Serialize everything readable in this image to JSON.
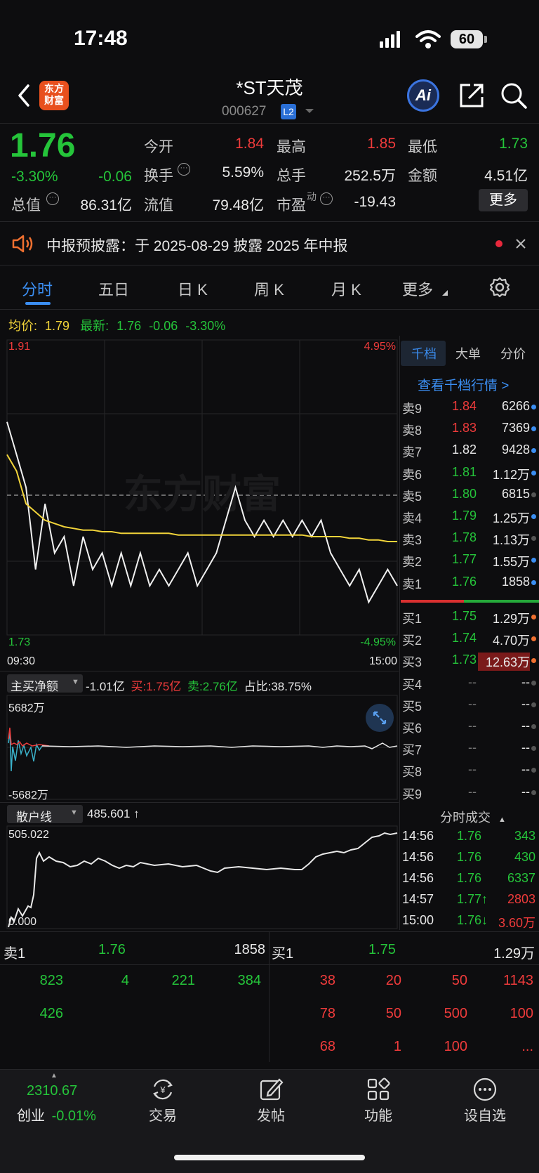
{
  "status_bar": {
    "time": "17:48",
    "battery": "60"
  },
  "header": {
    "logo_line1": "东方",
    "logo_line2": "财富",
    "stock_name": "*ST天茂",
    "stock_code": "000627",
    "level_badge": "L2",
    "ai_label": "Ai"
  },
  "quote": {
    "price": "1.76",
    "change_pct": "-3.30%",
    "change_amt": "-0.06",
    "open_label": "今开",
    "open": "1.84",
    "high_label": "最高",
    "high": "1.85",
    "low_label": "最低",
    "low": "1.73",
    "turnover_label": "换手",
    "turnover": "5.59%",
    "volume_label": "总手",
    "volume": "252.5万",
    "amount_label": "金额",
    "amount": "4.51亿",
    "mcap_label": "总值",
    "mcap": "86.31亿",
    "float_label": "流值",
    "float": "79.48亿",
    "pe_label": "市盈",
    "pe_super": "动",
    "pe": "-19.43",
    "more_button": "更多"
  },
  "notice": {
    "text": "中报预披露：于 2025-08-29 披露 2025 年中报"
  },
  "tabs": [
    "分时",
    "五日",
    "日 K",
    "周 K",
    "月 K",
    "更多"
  ],
  "info_line": {
    "avg_label": "均价:",
    "avg": "1.79",
    "latest_label": "最新:",
    "latest": "1.76",
    "chg": "-0.06",
    "pct": "-3.30%"
  },
  "chart": {
    "y_max_label": "1.91",
    "y_min_label": "1.73",
    "pct_max_label": "4.95%",
    "pct_min_label": "-4.95%",
    "time_start": "09:30",
    "time_end": "15:00",
    "watermark": "东方财富"
  },
  "chart_data": {
    "type": "line",
    "x_range": [
      "09:30",
      "15:00"
    ],
    "ylim": [
      1.73,
      1.91
    ],
    "pct_range": [
      -4.95,
      4.95
    ],
    "prev_close": 1.82,
    "series": [
      {
        "name": "最新",
        "values": [
          1.86,
          1.84,
          1.82,
          1.77,
          1.81,
          1.78,
          1.79,
          1.76,
          1.79,
          1.77,
          1.78,
          1.76,
          1.78,
          1.76,
          1.78,
          1.76,
          1.77,
          1.76,
          1.77,
          1.78,
          1.76,
          1.77,
          1.78,
          1.8,
          1.82,
          1.8,
          1.79,
          1.8,
          1.79,
          1.8,
          1.79,
          1.8,
          1.79,
          1.8,
          1.78,
          1.77,
          1.76,
          1.77,
          1.75,
          1.76,
          1.77,
          1.76
        ]
      },
      {
        "name": "均价",
        "values": [
          1.84,
          1.83,
          1.81,
          1.805,
          1.8,
          1.798,
          1.796,
          1.795,
          1.794,
          1.794,
          1.793,
          1.793,
          1.792,
          1.792,
          1.792,
          1.792,
          1.792,
          1.792,
          1.791,
          1.791,
          1.791,
          1.791,
          1.791,
          1.791,
          1.791,
          1.791,
          1.791,
          1.791,
          1.791,
          1.791,
          1.791,
          1.791,
          1.79,
          1.79,
          1.79,
          1.79,
          1.789,
          1.789,
          1.788,
          1.788,
          1.787,
          1.787
        ]
      }
    ]
  },
  "net_flow": {
    "label": "主买净额",
    "value": "-1.01亿",
    "buy_label": "买:",
    "buy": "1.75亿",
    "sell_label": "卖:",
    "sell": "2.76亿",
    "ratio_label": "占比:",
    "ratio": "38.75%",
    "max": "5682万",
    "min": "-5682万"
  },
  "retail": {
    "label": "散户线",
    "value": "485.601 ↑",
    "max": "505.022",
    "min": "0.000"
  },
  "right_panel": {
    "tabs": [
      "千档",
      "大单",
      "分价"
    ],
    "link": "查看千档行情 >",
    "asks": [
      {
        "label": "卖9",
        "price": "1.84",
        "vol": "6266",
        "color": "#ef3b3b",
        "dot": "#3b8ef2"
      },
      {
        "label": "卖8",
        "price": "1.83",
        "vol": "7369",
        "color": "#ef3b3b",
        "dot": "#3b8ef2"
      },
      {
        "label": "卖7",
        "price": "1.82",
        "vol": "9428",
        "color": "#e8e8e8",
        "dot": "#3b8ef2"
      },
      {
        "label": "卖6",
        "price": "1.81",
        "vol": "1.12万",
        "color": "#25c43a",
        "dot": "#3b8ef2"
      },
      {
        "label": "卖5",
        "price": "1.80",
        "vol": "6815",
        "color": "#25c43a",
        "dot": "#555555"
      },
      {
        "label": "卖4",
        "price": "1.79",
        "vol": "1.25万",
        "color": "#25c43a",
        "dot": "#3b8ef2"
      },
      {
        "label": "卖3",
        "price": "1.78",
        "vol": "1.13万",
        "color": "#25c43a",
        "dot": "#555555"
      },
      {
        "label": "卖2",
        "price": "1.77",
        "vol": "1.55万",
        "color": "#25c43a",
        "dot": "#3b8ef2"
      },
      {
        "label": "卖1",
        "price": "1.76",
        "vol": "1858",
        "color": "#25c43a",
        "dot": "#3b8ef2"
      }
    ],
    "bids": [
      {
        "label": "买1",
        "price": "1.75",
        "vol": "1.29万",
        "color": "#25c43a",
        "dot": "#f07030"
      },
      {
        "label": "买2",
        "price": "1.74",
        "vol": "4.70万",
        "color": "#25c43a",
        "dot": "#f07030"
      },
      {
        "label": "买3",
        "price": "1.73",
        "vol": "12.63万",
        "color": "#25c43a",
        "dot": "#f07030"
      },
      {
        "label": "买4",
        "price": "--",
        "vol": "--",
        "color": "#777777",
        "dot": "#555555"
      },
      {
        "label": "买5",
        "price": "--",
        "vol": "--",
        "color": "#777777",
        "dot": "#555555"
      },
      {
        "label": "买6",
        "price": "--",
        "vol": "--",
        "color": "#777777",
        "dot": "#555555"
      },
      {
        "label": "买7",
        "price": "--",
        "vol": "--",
        "color": "#777777",
        "dot": "#555555"
      },
      {
        "label": "买8",
        "price": "--",
        "vol": "--",
        "color": "#777777",
        "dot": "#555555"
      },
      {
        "label": "买9",
        "price": "--",
        "vol": "--",
        "color": "#777777",
        "dot": "#555555"
      }
    ],
    "ticks_title": "分时成交",
    "ticks": [
      {
        "time": "14:56",
        "price": "1.76",
        "vol": "343",
        "pcolor": "#25c43a",
        "vcolor": "#25c43a"
      },
      {
        "time": "14:56",
        "price": "1.76",
        "vol": "430",
        "pcolor": "#25c43a",
        "vcolor": "#25c43a"
      },
      {
        "time": "14:56",
        "price": "1.76",
        "vol": "6337",
        "pcolor": "#25c43a",
        "vcolor": "#25c43a"
      },
      {
        "time": "14:57",
        "price": "1.77↑",
        "vol": "2803",
        "pcolor": "#25c43a",
        "vcolor": "#ef3b3b"
      },
      {
        "time": "15:00",
        "price": "1.76↓",
        "vol": "3.60万",
        "pcolor": "#25c43a",
        "vcolor": "#ef3b3b"
      }
    ]
  },
  "bottom_book": {
    "sell_label": "卖1",
    "sell_price": "1.76",
    "sell_vol": "1858",
    "buy_label": "买1",
    "buy_price": "1.75",
    "buy_vol": "1.29万",
    "sell_queue": [
      "823",
      "4",
      "221",
      "384",
      "426"
    ],
    "buy_queue": [
      "38",
      "20",
      "50",
      "1143",
      "78",
      "50",
      "500",
      "100",
      "68",
      "1",
      "100",
      "..."
    ]
  },
  "bottom_nav": {
    "index_value": "2310.67",
    "index_name": "创业",
    "index_pct": "-0.01%",
    "items": [
      "交易",
      "发帖",
      "功能",
      "设自选"
    ]
  }
}
